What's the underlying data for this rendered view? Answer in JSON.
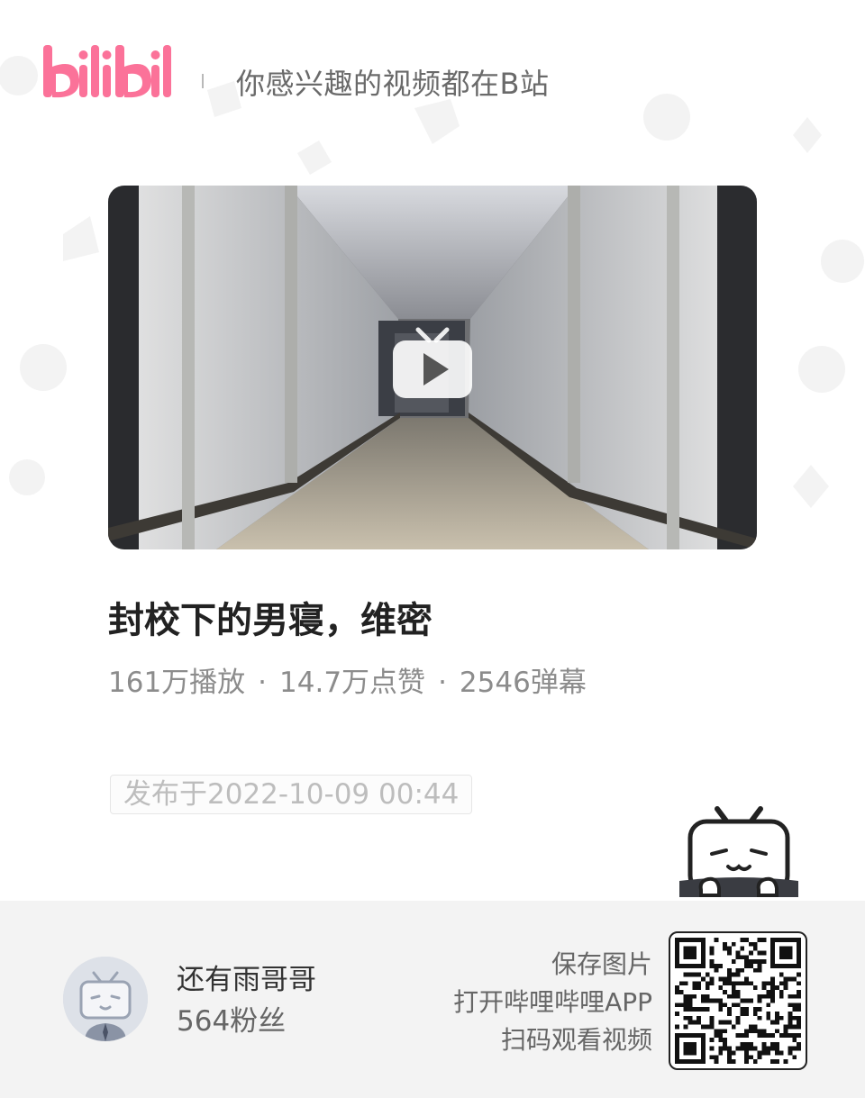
{
  "header": {
    "logo_text": "bilibili",
    "slogan": "你感兴趣的视频都在B站"
  },
  "video": {
    "title": "封校下的男寝，维密",
    "stats": {
      "plays": "161万播放",
      "likes": "14.7万点赞",
      "danmaku": "2546弹幕",
      "separator": "·"
    },
    "publish_date": "发布于2022-10-09 00:44"
  },
  "uploader": {
    "name": "还有雨哥哥",
    "followers": "564粉丝"
  },
  "cta": {
    "line1": "保存图片",
    "line2": "打开哔哩哔哩APP",
    "line3": "扫码观看视频"
  },
  "icons": [
    "bilibili-logo",
    "play-icon",
    "tv-mascot-icon",
    "qr-code",
    "avatar-tv-icon"
  ],
  "colors": {
    "brand_pink": "#FB7299",
    "footer_bg": "#F3F3F3",
    "title_text": "#222222",
    "muted_text": "#8C8C8C"
  }
}
